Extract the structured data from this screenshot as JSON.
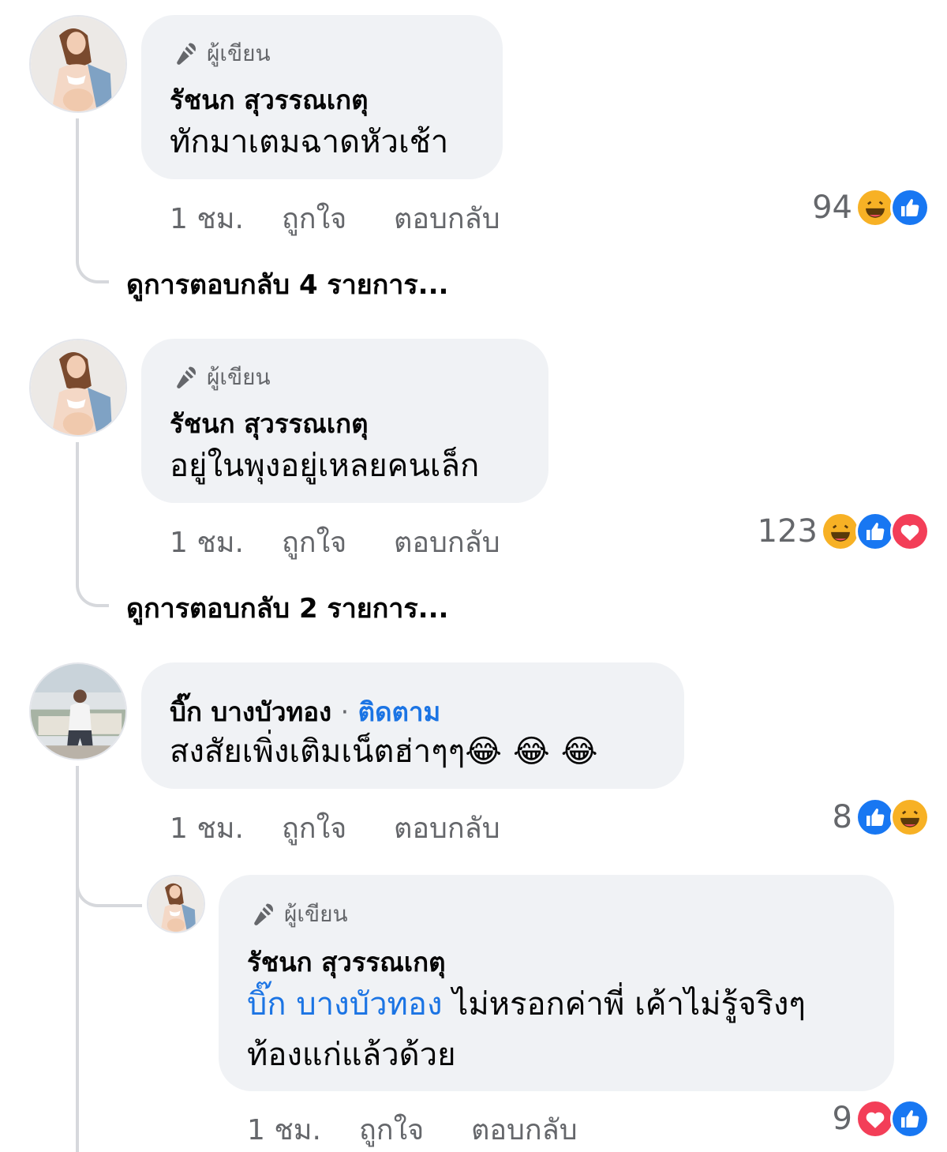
{
  "comments": [
    {
      "badge": "ผู้เขียน",
      "name": "รัชนก สุวรรณเกตุ",
      "text": "ทักมาเตมฉาดหัวเช้า",
      "time": "1 ชม.",
      "like": "ถูกใจ",
      "reply": "ตอบกลับ",
      "reaction_count": "94",
      "reactions": [
        "haha-icon",
        "like-icon"
      ],
      "view_replies": "ดูการตอบกลับ 4 รายการ..."
    },
    {
      "badge": "ผู้เขียน",
      "name": "รัชนก สุวรรณเกตุ",
      "text": "อยู่ในพุงอยู่เหลยคนเล็ก",
      "time": "1 ชม.",
      "like": "ถูกใจ",
      "reply": "ตอบกลับ",
      "reaction_count": "123",
      "reactions": [
        "haha-icon",
        "like-icon",
        "love-icon"
      ],
      "view_replies": "ดูการตอบกลับ 2 รายการ..."
    },
    {
      "name": "บิ๊ก บางบัวทอง",
      "separator": "·",
      "follow": "ติดตาม",
      "text": "สงสัยเพิ่งเติมเน็ตฮ่าๆๆ",
      "emoji": "😂😂😂",
      "time": "1 ชม.",
      "like": "ถูกใจ",
      "reply": "ตอบกลับ",
      "reaction_count": "8",
      "reactions": [
        "like-icon",
        "haha-icon"
      ]
    }
  ],
  "reply": {
    "badge": "ผู้เขียน",
    "name": "รัชนก สุวรรณเกตุ",
    "mention": "บิ๊ก บางบัวทอง",
    "text_line1": " ไม่หรอกค่าพี่ เค้าไม่รู้จริงๆ",
    "text_line2": "ท้องแก่แล้วด้วย",
    "time": "1 ชม.",
    "like": "ถูกใจ",
    "reply": "ตอบกลับ",
    "reaction_count": "9",
    "reactions": [
      "love-icon",
      "like-icon"
    ]
  },
  "colors": {
    "bubble": "#f0f2f5",
    "link": "#1b74e4",
    "meta": "#65676b",
    "like": "#1877f2",
    "love": "#f33e58",
    "haha": "#f7b125"
  }
}
